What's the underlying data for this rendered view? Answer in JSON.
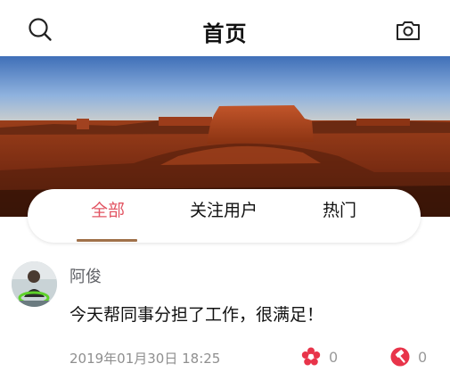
{
  "header": {
    "title": "首页",
    "search_icon": "search-icon",
    "camera_icon": "camera-icon"
  },
  "banner": {
    "description_icon": "landscape-banner-image"
  },
  "tabs": [
    {
      "label": "全部",
      "active": true
    },
    {
      "label": "关注用户",
      "active": false
    },
    {
      "label": "热门",
      "active": false
    }
  ],
  "post": {
    "username": "阿俊",
    "text": "今天帮同事分担了工作，很满足！",
    "time": "2019年01月30日 18:25",
    "likes": "0",
    "hammers": "0"
  },
  "colors": {
    "accent": "#e25563",
    "tab_underline": "#a0714a",
    "like_icon": "#e8344a",
    "hammer_icon": "#e8344a"
  }
}
